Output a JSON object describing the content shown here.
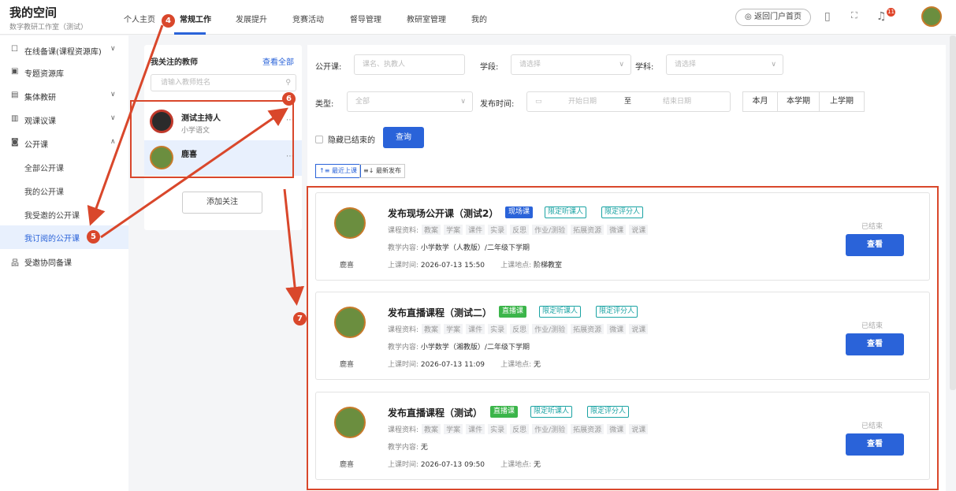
{
  "app": {
    "title": "我的空间",
    "subtitle": "数字教研工作室（测试）"
  },
  "nav": [
    {
      "label": "个人主页"
    },
    {
      "label": "常规工作"
    },
    {
      "label": "发展提升"
    },
    {
      "label": "竞赛活动"
    },
    {
      "label": "督导管理"
    },
    {
      "label": "教研室管理"
    },
    {
      "label": "我的"
    }
  ],
  "header": {
    "back_label": "返回门户首页",
    "notification_count": "11"
  },
  "sidebar": [
    {
      "label": "在线备课(课程资源库)",
      "icon": "document-icon",
      "chev": "∨"
    },
    {
      "label": "专题资源库",
      "icon": "folder-icon",
      "chev": ""
    },
    {
      "label": "集体教研",
      "icon": "list-icon",
      "chev": "∨"
    },
    {
      "label": "观课议课",
      "icon": "monitor-icon",
      "chev": "∨"
    },
    {
      "label": "公开课",
      "icon": "video-icon",
      "chev": "∧"
    },
    {
      "label": "全部公开课",
      "icon": "",
      "chev": ""
    },
    {
      "label": "我的公开课",
      "icon": "",
      "chev": ""
    },
    {
      "label": "我受邀的公开课",
      "icon": "",
      "chev": ""
    },
    {
      "label": "我订阅的公开课",
      "icon": "",
      "chev": ""
    },
    {
      "label": "受邀协同备课",
      "icon": "collab-icon",
      "chev": ""
    }
  ],
  "teacher_panel": {
    "title": "我关注的教师",
    "view_all": "查看全部",
    "search_placeholder": "请输入教师姓名",
    "teachers": [
      {
        "name": "测试主持人",
        "subject": "小学语文"
      },
      {
        "name": "鹿喜",
        "subject": ""
      }
    ],
    "add_label": "添加关注"
  },
  "filters": {
    "course_label": "公开课:",
    "course_placeholder": "课名、执教人",
    "stage_label": "学段:",
    "stage_placeholder": "请选择",
    "subject_label": "学科:",
    "subject_placeholder": "请选择",
    "type_label": "类型:",
    "type_value": "全部",
    "time_label": "发布时间:",
    "start_placeholder": "开始日期",
    "to": "至",
    "end_placeholder": "结束日期",
    "ranges": [
      "本月",
      "本学期",
      "上学期"
    ],
    "hide_ended": "隐藏已结束的",
    "query": "查询",
    "sort_recent": "最近上课",
    "sort_new": "最新发布"
  },
  "labels": {
    "materials": "课程资料:",
    "content": "教学内容:",
    "time": "上课时间:",
    "place": "上课地点:",
    "status": "已结束",
    "view": "查看"
  },
  "resources": [
    "教案",
    "学案",
    "课件",
    "实录",
    "反思",
    "作业/测验",
    "拓展资源",
    "微课",
    "说课"
  ],
  "courses": [
    {
      "title": "发布现场公开课（测试2）",
      "type": "现场课",
      "type_color": "blue",
      "tags": [
        "限定听课人",
        "限定评分人"
      ],
      "teacher": "鹿喜",
      "content": "小学数学（人教版）/二年级下学期",
      "time": "2026-07-13 15:50",
      "place": "阶梯教室"
    },
    {
      "title": "发布直播课程（测试二）",
      "type": "直播课",
      "type_color": "green",
      "tags": [
        "限定听课人",
        "限定评分人"
      ],
      "teacher": "鹿喜",
      "content": "小学数学（湘教版）/二年级下学期",
      "time": "2026-07-13 11:09",
      "place": "无"
    },
    {
      "title": "发布直播课程（测试）",
      "type": "直播课",
      "type_color": "green",
      "tags": [
        "限定听课人",
        "限定评分人"
      ],
      "teacher": "鹿喜",
      "content": "无",
      "time": "2026-07-13 09:50",
      "place": "无"
    }
  ],
  "annotations": [
    "4",
    "5",
    "6",
    "7"
  ],
  "colors": {
    "accent": "#2a63d9",
    "annotation": "#d9472b",
    "live": "#3bb54a",
    "tag_outline": "#1aa3a3"
  }
}
